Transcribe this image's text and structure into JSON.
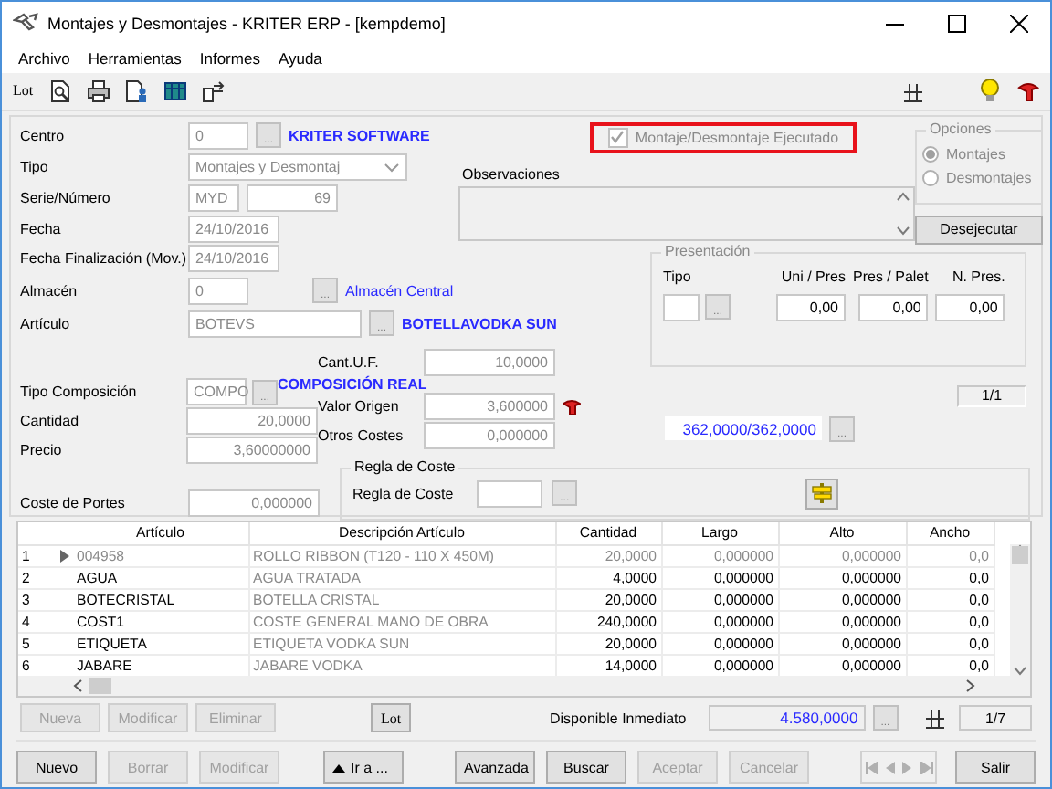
{
  "window": {
    "title": "Montajes y Desmontajes - KRITER ERP - [kempdemo]"
  },
  "menu": [
    {
      "label": "Archivo"
    },
    {
      "label": "Herramientas"
    },
    {
      "label": "Informes"
    },
    {
      "label": "Ayuda"
    }
  ],
  "toolbar": {
    "lot": "Lot"
  },
  "centro": {
    "label": "Centro",
    "value": "0",
    "button": "...",
    "description": "KRITER SOFTWARE"
  },
  "tipo": {
    "label": "Tipo",
    "value": "Montajes y Desmontaj"
  },
  "serie_numero": {
    "label": "Serie/Número",
    "serie": "MYD",
    "numero": "69"
  },
  "fecha": {
    "label": "Fecha",
    "value": "24/10/2016"
  },
  "executed_checkbox": {
    "label": "Montaje/Desmontaje Ejecutado",
    "checked": true,
    "disabled": true,
    "highlighted": true
  },
  "observaciones": {
    "label": "Observaciones"
  },
  "opciones": {
    "title": "Opciones",
    "disabled": true,
    "options": [
      {
        "label": "Montajes",
        "selected": true
      },
      {
        "label": "Desmontajes",
        "selected": false
      }
    ]
  },
  "desejecutar_button": {
    "label": "Desejecutar"
  },
  "fecha_finalizacion": {
    "label": "Fecha Finalización (Mov.)",
    "value": "24/10/2016"
  },
  "almacen": {
    "label": "Almacén",
    "value": "0",
    "button": "...",
    "description": "Almacén Central"
  },
  "articulo": {
    "label": "Artículo",
    "value": "BOTEVS",
    "button": "...",
    "description": "BOTELLAVODKA SUN"
  },
  "presentacion": {
    "title": "Presentación",
    "disabled": true,
    "tipo_label": "Tipo",
    "tipo_button": "...",
    "fields": [
      {
        "label": "Uni / Pres",
        "value": "0,00"
      },
      {
        "label": "Pres / Palet",
        "value": "0,00"
      },
      {
        "label": "N. Pres.",
        "value": "0,00"
      }
    ]
  },
  "composicion": {
    "tipo": {
      "label": "Tipo Composición",
      "value": "COMPO",
      "button": "...",
      "description": "COMPOSICIÓN REAL"
    },
    "cant_uf": {
      "label": "Cant.U.F.",
      "value": "10,0000"
    },
    "valor_origen": {
      "label": "Valor Origen",
      "value": "3,600000"
    },
    "cantidad": {
      "label": "Cantidad",
      "value": "20,0000"
    },
    "otros_costes": {
      "label": "Otros Costes",
      "value": "0,000000"
    },
    "precio": {
      "label": "Precio",
      "value": "3,60000000"
    },
    "coste_portes": {
      "label": "Coste de Portes",
      "value": "0,000000"
    },
    "regla_coste": {
      "title": "Regla de Coste",
      "label": "Regla de Coste",
      "button": "..."
    }
  },
  "record_counter": "1/1",
  "stock": {
    "value": "362,0000/362,0000",
    "button": "..."
  },
  "grid": {
    "columns": [
      {
        "label": "Artículo",
        "kind": "code"
      },
      {
        "label": "Descripción Artículo",
        "kind": "description"
      },
      {
        "label": "Cantidad",
        "kind": "number"
      },
      {
        "label": "Largo",
        "kind": "number"
      },
      {
        "label": "Alto",
        "kind": "number"
      },
      {
        "label": "Ancho",
        "kind": "number"
      }
    ],
    "rows": [
      {
        "number": "1",
        "current": true,
        "cells": [
          "004958",
          "ROLLO RIBBON (T120 - 110 X 450M)",
          "20,0000",
          "0,000000",
          "0,000000",
          "0,0"
        ]
      },
      {
        "number": "2",
        "current": false,
        "cells": [
          "AGUA",
          "AGUA TRATADA",
          "4,0000",
          "0,000000",
          "0,000000",
          "0,0"
        ]
      },
      {
        "number": "3",
        "current": false,
        "cells": [
          "BOTECRISTAL",
          "BOTELLA CRISTAL",
          "20,0000",
          "0,000000",
          "0,000000",
          "0,0"
        ]
      },
      {
        "number": "4",
        "current": false,
        "cells": [
          "COST1",
          "COSTE GENERAL MANO DE OBRA",
          "240,0000",
          "0,000000",
          "0,000000",
          "0,0"
        ]
      },
      {
        "number": "5",
        "current": false,
        "cells": [
          "ETIQUETA",
          "ETIQUETA VODKA SUN",
          "20,0000",
          "0,000000",
          "0,000000",
          "0,0"
        ]
      },
      {
        "number": "6",
        "current": false,
        "cells": [
          "JABARE",
          "JABARE VODKA",
          "14,0000",
          "0,000000",
          "0,000000",
          "0,0"
        ]
      }
    ]
  },
  "grid_actions": [
    {
      "label": "Nueva",
      "disabled": true
    },
    {
      "label": "Modificar",
      "disabled": true
    },
    {
      "label": "Eliminar",
      "disabled": true
    }
  ],
  "lot_button": {
    "label": "Lot",
    "disabled": false
  },
  "disponible": {
    "label": "Disponible Inmediato",
    "value": "4.580,0000",
    "button": "..."
  },
  "line_counter": "1/7",
  "record_buttons": [
    {
      "label": "Nuevo",
      "disabled": false
    },
    {
      "label": "Borrar",
      "disabled": true
    },
    {
      "label": "Modificar",
      "disabled": true
    }
  ],
  "goto_button": {
    "label": "Ir a ..."
  },
  "search_buttons": [
    {
      "label": "Avanzada",
      "disabled": false
    },
    {
      "label": "Buscar",
      "disabled": false
    }
  ],
  "confirm_buttons": [
    {
      "label": "Aceptar",
      "disabled": true
    },
    {
      "label": "Cancelar",
      "disabled": true
    }
  ],
  "navigation": {
    "disabled": true
  },
  "exit_button": {
    "label": "Salir"
  }
}
